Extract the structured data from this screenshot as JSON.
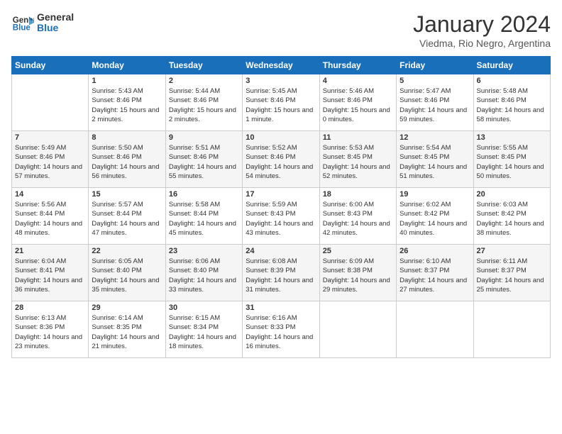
{
  "logo": {
    "line1": "General",
    "line2": "Blue"
  },
  "title": "January 2024",
  "location": "Viedma, Rio Negro, Argentina",
  "weekdays": [
    "Sunday",
    "Monday",
    "Tuesday",
    "Wednesday",
    "Thursday",
    "Friday",
    "Saturday"
  ],
  "weeks": [
    [
      {
        "day": "",
        "sunrise": "",
        "sunset": "",
        "daylight": ""
      },
      {
        "day": "1",
        "sunrise": "Sunrise: 5:43 AM",
        "sunset": "Sunset: 8:46 PM",
        "daylight": "Daylight: 15 hours and 2 minutes."
      },
      {
        "day": "2",
        "sunrise": "Sunrise: 5:44 AM",
        "sunset": "Sunset: 8:46 PM",
        "daylight": "Daylight: 15 hours and 2 minutes."
      },
      {
        "day": "3",
        "sunrise": "Sunrise: 5:45 AM",
        "sunset": "Sunset: 8:46 PM",
        "daylight": "Daylight: 15 hours and 1 minute."
      },
      {
        "day": "4",
        "sunrise": "Sunrise: 5:46 AM",
        "sunset": "Sunset: 8:46 PM",
        "daylight": "Daylight: 15 hours and 0 minutes."
      },
      {
        "day": "5",
        "sunrise": "Sunrise: 5:47 AM",
        "sunset": "Sunset: 8:46 PM",
        "daylight": "Daylight: 14 hours and 59 minutes."
      },
      {
        "day": "6",
        "sunrise": "Sunrise: 5:48 AM",
        "sunset": "Sunset: 8:46 PM",
        "daylight": "Daylight: 14 hours and 58 minutes."
      }
    ],
    [
      {
        "day": "7",
        "sunrise": "Sunrise: 5:49 AM",
        "sunset": "Sunset: 8:46 PM",
        "daylight": "Daylight: 14 hours and 57 minutes."
      },
      {
        "day": "8",
        "sunrise": "Sunrise: 5:50 AM",
        "sunset": "Sunset: 8:46 PM",
        "daylight": "Daylight: 14 hours and 56 minutes."
      },
      {
        "day": "9",
        "sunrise": "Sunrise: 5:51 AM",
        "sunset": "Sunset: 8:46 PM",
        "daylight": "Daylight: 14 hours and 55 minutes."
      },
      {
        "day": "10",
        "sunrise": "Sunrise: 5:52 AM",
        "sunset": "Sunset: 8:46 PM",
        "daylight": "Daylight: 14 hours and 54 minutes."
      },
      {
        "day": "11",
        "sunrise": "Sunrise: 5:53 AM",
        "sunset": "Sunset: 8:45 PM",
        "daylight": "Daylight: 14 hours and 52 minutes."
      },
      {
        "day": "12",
        "sunrise": "Sunrise: 5:54 AM",
        "sunset": "Sunset: 8:45 PM",
        "daylight": "Daylight: 14 hours and 51 minutes."
      },
      {
        "day": "13",
        "sunrise": "Sunrise: 5:55 AM",
        "sunset": "Sunset: 8:45 PM",
        "daylight": "Daylight: 14 hours and 50 minutes."
      }
    ],
    [
      {
        "day": "14",
        "sunrise": "Sunrise: 5:56 AM",
        "sunset": "Sunset: 8:44 PM",
        "daylight": "Daylight: 14 hours and 48 minutes."
      },
      {
        "day": "15",
        "sunrise": "Sunrise: 5:57 AM",
        "sunset": "Sunset: 8:44 PM",
        "daylight": "Daylight: 14 hours and 47 minutes."
      },
      {
        "day": "16",
        "sunrise": "Sunrise: 5:58 AM",
        "sunset": "Sunset: 8:44 PM",
        "daylight": "Daylight: 14 hours and 45 minutes."
      },
      {
        "day": "17",
        "sunrise": "Sunrise: 5:59 AM",
        "sunset": "Sunset: 8:43 PM",
        "daylight": "Daylight: 14 hours and 43 minutes."
      },
      {
        "day": "18",
        "sunrise": "Sunrise: 6:00 AM",
        "sunset": "Sunset: 8:43 PM",
        "daylight": "Daylight: 14 hours and 42 minutes."
      },
      {
        "day": "19",
        "sunrise": "Sunrise: 6:02 AM",
        "sunset": "Sunset: 8:42 PM",
        "daylight": "Daylight: 14 hours and 40 minutes."
      },
      {
        "day": "20",
        "sunrise": "Sunrise: 6:03 AM",
        "sunset": "Sunset: 8:42 PM",
        "daylight": "Daylight: 14 hours and 38 minutes."
      }
    ],
    [
      {
        "day": "21",
        "sunrise": "Sunrise: 6:04 AM",
        "sunset": "Sunset: 8:41 PM",
        "daylight": "Daylight: 14 hours and 36 minutes."
      },
      {
        "day": "22",
        "sunrise": "Sunrise: 6:05 AM",
        "sunset": "Sunset: 8:40 PM",
        "daylight": "Daylight: 14 hours and 35 minutes."
      },
      {
        "day": "23",
        "sunrise": "Sunrise: 6:06 AM",
        "sunset": "Sunset: 8:40 PM",
        "daylight": "Daylight: 14 hours and 33 minutes."
      },
      {
        "day": "24",
        "sunrise": "Sunrise: 6:08 AM",
        "sunset": "Sunset: 8:39 PM",
        "daylight": "Daylight: 14 hours and 31 minutes."
      },
      {
        "day": "25",
        "sunrise": "Sunrise: 6:09 AM",
        "sunset": "Sunset: 8:38 PM",
        "daylight": "Daylight: 14 hours and 29 minutes."
      },
      {
        "day": "26",
        "sunrise": "Sunrise: 6:10 AM",
        "sunset": "Sunset: 8:37 PM",
        "daylight": "Daylight: 14 hours and 27 minutes."
      },
      {
        "day": "27",
        "sunrise": "Sunrise: 6:11 AM",
        "sunset": "Sunset: 8:37 PM",
        "daylight": "Daylight: 14 hours and 25 minutes."
      }
    ],
    [
      {
        "day": "28",
        "sunrise": "Sunrise: 6:13 AM",
        "sunset": "Sunset: 8:36 PM",
        "daylight": "Daylight: 14 hours and 23 minutes."
      },
      {
        "day": "29",
        "sunrise": "Sunrise: 6:14 AM",
        "sunset": "Sunset: 8:35 PM",
        "daylight": "Daylight: 14 hours and 21 minutes."
      },
      {
        "day": "30",
        "sunrise": "Sunrise: 6:15 AM",
        "sunset": "Sunset: 8:34 PM",
        "daylight": "Daylight: 14 hours and 18 minutes."
      },
      {
        "day": "31",
        "sunrise": "Sunrise: 6:16 AM",
        "sunset": "Sunset: 8:33 PM",
        "daylight": "Daylight: 14 hours and 16 minutes."
      },
      {
        "day": "",
        "sunrise": "",
        "sunset": "",
        "daylight": ""
      },
      {
        "day": "",
        "sunrise": "",
        "sunset": "",
        "daylight": ""
      },
      {
        "day": "",
        "sunrise": "",
        "sunset": "",
        "daylight": ""
      }
    ]
  ]
}
